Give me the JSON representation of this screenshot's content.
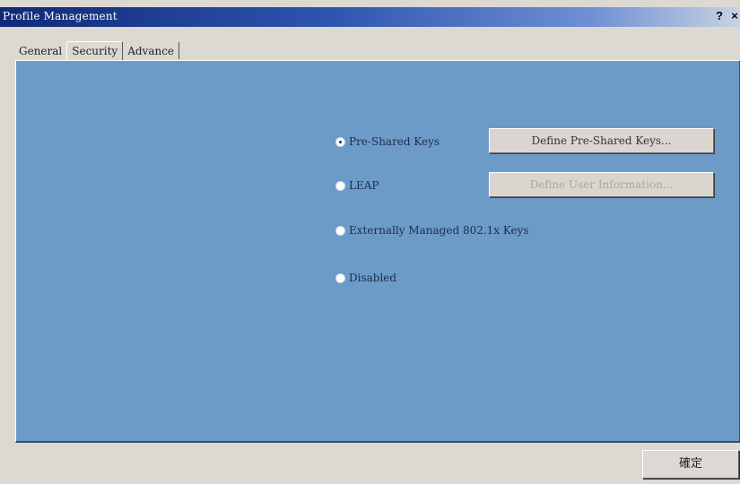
{
  "window": {
    "title": "Profile Management",
    "help_label": "?",
    "close_label": "×"
  },
  "tabs": [
    {
      "label": "General"
    },
    {
      "label": "Security",
      "selected": true
    },
    {
      "label": "Advance"
    }
  ],
  "security": {
    "options": [
      {
        "label": "Pre-Shared Keys",
        "checked": true
      },
      {
        "label": "LEAP",
        "checked": false
      },
      {
        "label": "Externally Managed 802.1x Keys",
        "checked": false
      },
      {
        "label": "Disabled",
        "checked": false
      }
    ],
    "define_psk_label": "Define Pre-Shared Keys...",
    "define_user_label": "Define User Information...",
    "define_user_enabled": false
  },
  "footer": {
    "ok_label": "確定"
  },
  "colors": {
    "panel_background": "#6c9bc8",
    "titlebar_start": "#0f2a78",
    "dialog_background": "#dcd9d2"
  }
}
